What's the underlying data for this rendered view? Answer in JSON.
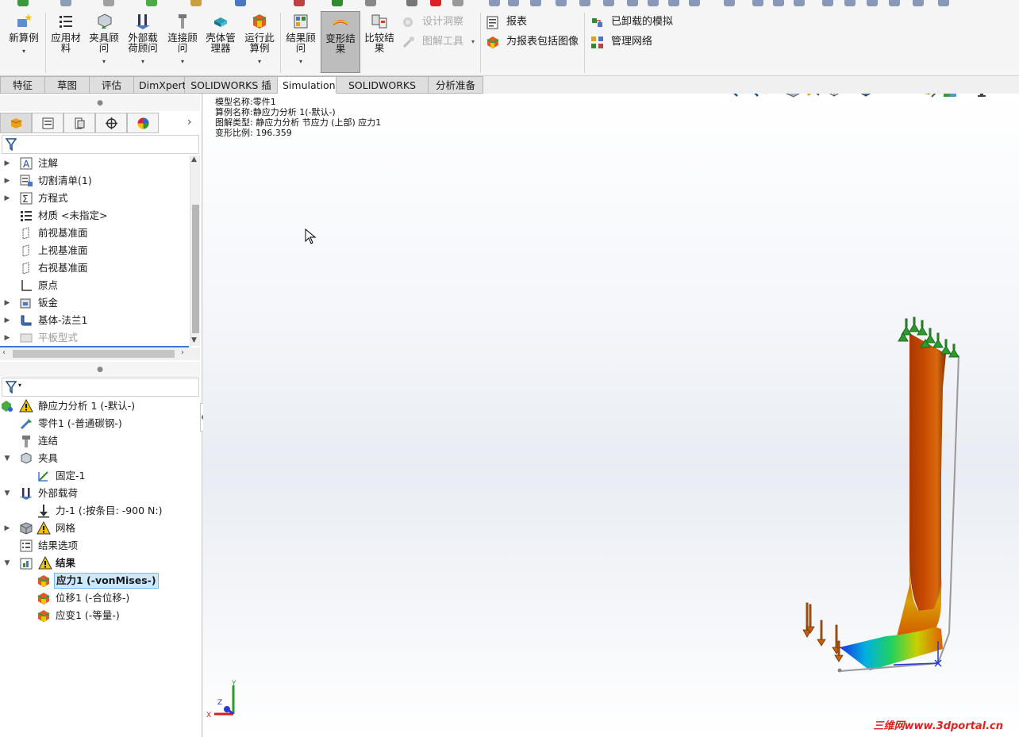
{
  "ribbon": {
    "new_study": "新算例",
    "apply_material": "应用材\n料",
    "fixtures_advisor": "夹具顾\n问",
    "external_loads_advisor": "外部载\n荷顾问",
    "connections_advisor": "连接顾\n问",
    "shell_manager": "壳体管\n理器",
    "run_study": "运行此\n算例",
    "results_advisor": "结果顾\n问",
    "deformed_result": "变形结\n果",
    "compare_results": "比较结\n果",
    "design_insight": "设计洞察",
    "plot_tools": "图解工具",
    "report": "报表",
    "include_image_report": "为报表包括图像",
    "unloaded_simulations": "已卸载的模拟",
    "manage_network": "管理网络"
  },
  "tabs": [
    "特征",
    "草图",
    "评估",
    "DimXpert",
    "SOLIDWORKS 插件",
    "Simulation",
    "SOLIDWORKS MBD",
    "分析准备"
  ],
  "feature_tree": {
    "items": [
      {
        "label": "注解"
      },
      {
        "label": "切割清单(1)"
      },
      {
        "label": "方程式"
      },
      {
        "label": "材质 <未指定>"
      },
      {
        "label": "前视基准面"
      },
      {
        "label": "上视基准面"
      },
      {
        "label": "右视基准面"
      },
      {
        "label": "原点"
      },
      {
        "label": "钣金"
      },
      {
        "label": "基体-法兰1"
      },
      {
        "label": "平板型式"
      }
    ]
  },
  "sim_tree": {
    "items": [
      {
        "label": "静应力分析 1 (-默认-)"
      },
      {
        "label": "零件1 (-普通碳钢-)"
      },
      {
        "label": "连结"
      },
      {
        "label": "夹具"
      },
      {
        "label": "固定-1"
      },
      {
        "label": "外部载荷"
      },
      {
        "label": "力-1 (:按条目: -900 N:)"
      },
      {
        "label": "网格"
      },
      {
        "label": "结果选项"
      },
      {
        "label": "结果"
      },
      {
        "label": "应力1 (-vonMises-)"
      },
      {
        "label": "位移1 (-合位移-)"
      },
      {
        "label": "应变1 (-等量-)"
      }
    ]
  },
  "viewport": {
    "model_name": "模型名称:零件1",
    "study_name": "算例名称:静应力分析 1(-默认-)",
    "plot_type": "图解类型: 静应力分析 节应力 (上部) 应力1",
    "deformation_scale": "变形比例: 196.359",
    "triad_x": "X",
    "triad_y": "Y",
    "triad_z": "Z",
    "watermark": "三维网www.3dportal.cn"
  },
  "colors": {
    "accent_blue": "#2d7ed4",
    "active_tab": "#ffffff",
    "warning": "#f5c400"
  }
}
